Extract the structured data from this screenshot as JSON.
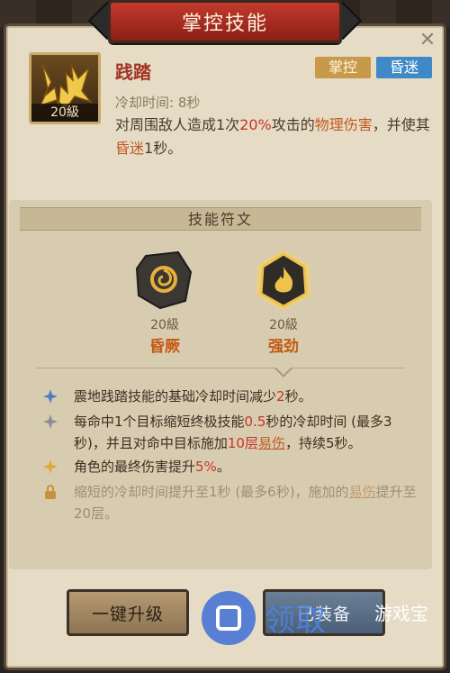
{
  "window": {
    "title": "掌控技能"
  },
  "skill": {
    "name": "践踏",
    "level_label": "20級",
    "tags": [
      "掌控",
      "昏迷"
    ],
    "cooldown": "冷却时间: 8秒",
    "desc_parts": [
      "对周围敌人造成1次",
      "20%",
      "攻击的",
      "物理伤害",
      "，并使其",
      "昏迷",
      "1秒。"
    ]
  },
  "runes": {
    "header": "技能符文",
    "items": [
      {
        "level": "20級",
        "name": "昏厥"
      },
      {
        "level": "20級",
        "name": "强劲"
      }
    ]
  },
  "effects": [
    {
      "parts": [
        "震地践踏技能的基础冷却时间减少",
        "2",
        "秒。"
      ]
    },
    {
      "parts": [
        "每命中1个目标缩短终极技能",
        "0.5",
        "秒的冷却时间 (最多3秒)，并且对命中目标施加",
        "10层",
        "易伤",
        "，持续5秒。"
      ]
    },
    {
      "parts": [
        "角色的最终伤害提升",
        "5%",
        "。"
      ]
    },
    {
      "parts": [
        "缩短的冷却时间提升至1秒 (最多6秒)，施加的",
        "易伤",
        "提升至20层。"
      ]
    }
  ],
  "buttons": {
    "upgrade": "一键升级",
    "equip": "已装备"
  },
  "watermark": {
    "text": "游戏宝",
    "brand": "领取"
  },
  "colors": {
    "accent_red": "#c8332a",
    "tag_gold": "#c79a4a",
    "tag_blue": "#3f8ac6"
  },
  "icons": {
    "close": "close-icon",
    "effect_blue": "star-blue-icon",
    "effect_gray": "star-gray-icon",
    "effect_gold": "star-gold-icon",
    "effect_lock": "lock-icon"
  }
}
